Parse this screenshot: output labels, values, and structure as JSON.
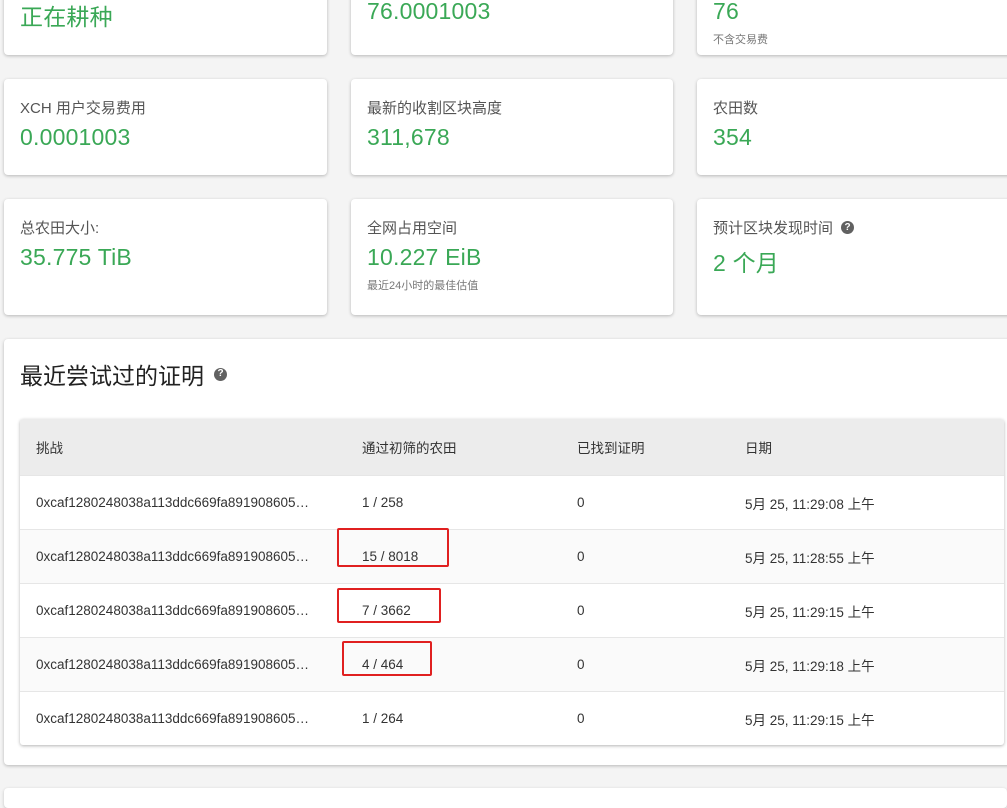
{
  "top_row": {
    "card1_value": "正在耕种",
    "card2_value": "76.0001003",
    "card3_value": "76",
    "card3_caption": "不含交易费"
  },
  "stats": {
    "fees_title": "XCH 用户交易费用",
    "fees_value": "0.0001003",
    "height_title": "最新的收割区块高度",
    "height_value": "311,678",
    "plots_title": "农田数",
    "plots_value": "354",
    "size_title": "总农田大小:",
    "size_value": "35.775 TiB",
    "netspace_title": "全网占用空间",
    "netspace_value": "10.227 EiB",
    "netspace_caption": "最近24小时的最佳估值",
    "eta_title": "预计区块发现时间",
    "eta_value": "2 个月"
  },
  "proofs": {
    "title": "最近尝试过的证明",
    "headers": [
      "挑战",
      "通过初筛的农田",
      "已找到证明",
      "日期"
    ],
    "rows": [
      {
        "challenge": "0xcaf1280248038a113ddc669fa891908605…",
        "plots": "1 / 258",
        "found": "0",
        "date": "5月 25, 11:29:08 上午"
      },
      {
        "challenge": "0xcaf1280248038a113ddc669fa891908605…",
        "plots": "15 / 8018",
        "found": "0",
        "date": "5月 25, 11:28:55 上午"
      },
      {
        "challenge": "0xcaf1280248038a113ddc669fa891908605…",
        "plots": "7 / 3662",
        "found": "0",
        "date": "5月 25, 11:29:15 上午"
      },
      {
        "challenge": "0xcaf1280248038a113ddc669fa891908605…",
        "plots": "4 / 464",
        "found": "0",
        "date": "5月 25, 11:29:18 上午"
      },
      {
        "challenge": "0xcaf1280248038a113ddc669fa891908605…",
        "plots": "1 / 264",
        "found": "0",
        "date": "5月 25, 11:29:15 上午"
      }
    ]
  },
  "colors": {
    "accent_green": "#3aa856",
    "highlight_red": "#e02020"
  },
  "icons": {
    "help": "help-circle-icon"
  }
}
